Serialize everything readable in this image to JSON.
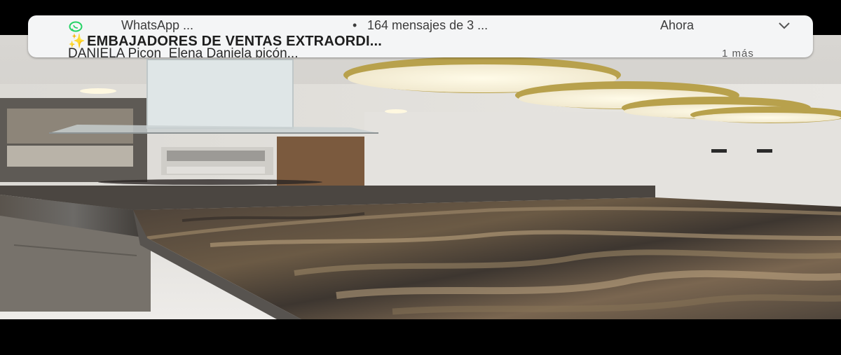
{
  "notification": {
    "app_name": "WhatsApp ...",
    "separator": "•",
    "message_count": "164 mensajes de 3 ...",
    "time": "Ahora",
    "title_emoji": "✨",
    "title": "EMBAJADORES DE VENTAS EXTRAORDI...",
    "sender": "DANIELA Picon",
    "message_preview": "Elena Daniela picón...",
    "more": "1 más"
  },
  "icons": {
    "app": "whatsapp-icon",
    "expand": "chevron-down-icon"
  },
  "colors": {
    "notification_bg": "#f4f5f6",
    "whatsapp_green": "#25d366",
    "lamp_brass": "#b9a24a"
  }
}
